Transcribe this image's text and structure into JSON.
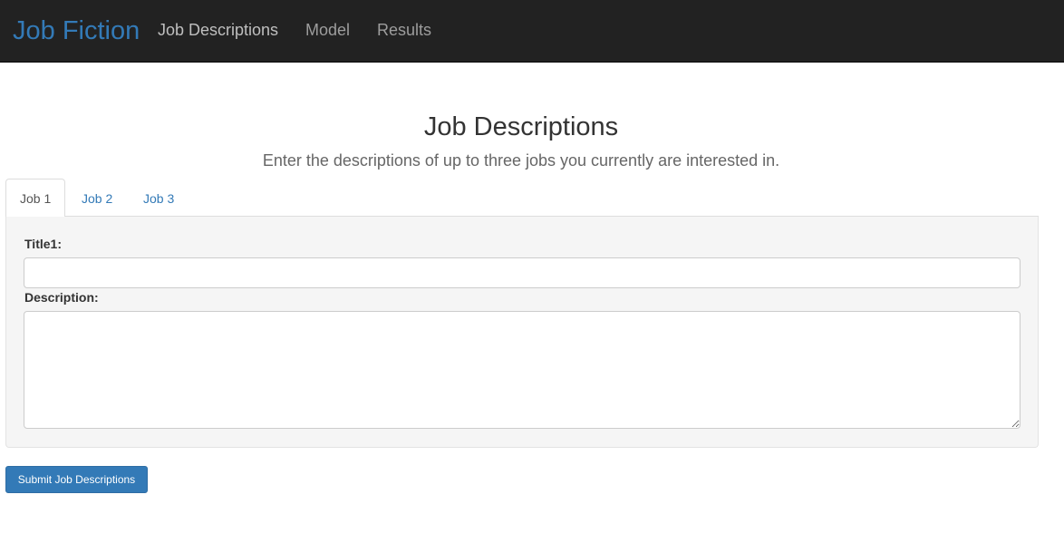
{
  "navbar": {
    "brand": "Job Fiction",
    "links": [
      "Job Descriptions",
      "Model",
      "Results"
    ]
  },
  "main": {
    "title": "Job Descriptions",
    "subtitle": "Enter the descriptions of up to three jobs you currently are interested in."
  },
  "tabs": [
    "Job 1",
    "Job 2",
    "Job 3"
  ],
  "active_tab": "Job 1",
  "form": {
    "title_label": "Title1:",
    "title_value": "",
    "description_label": "Description:",
    "description_value": ""
  },
  "submit_label": "Submit Job Descriptions",
  "colors": {
    "navbar_bg": "#222222",
    "brand": "#337ab7",
    "primary_button": "#337ab7",
    "well_bg": "#f5f5f5"
  }
}
